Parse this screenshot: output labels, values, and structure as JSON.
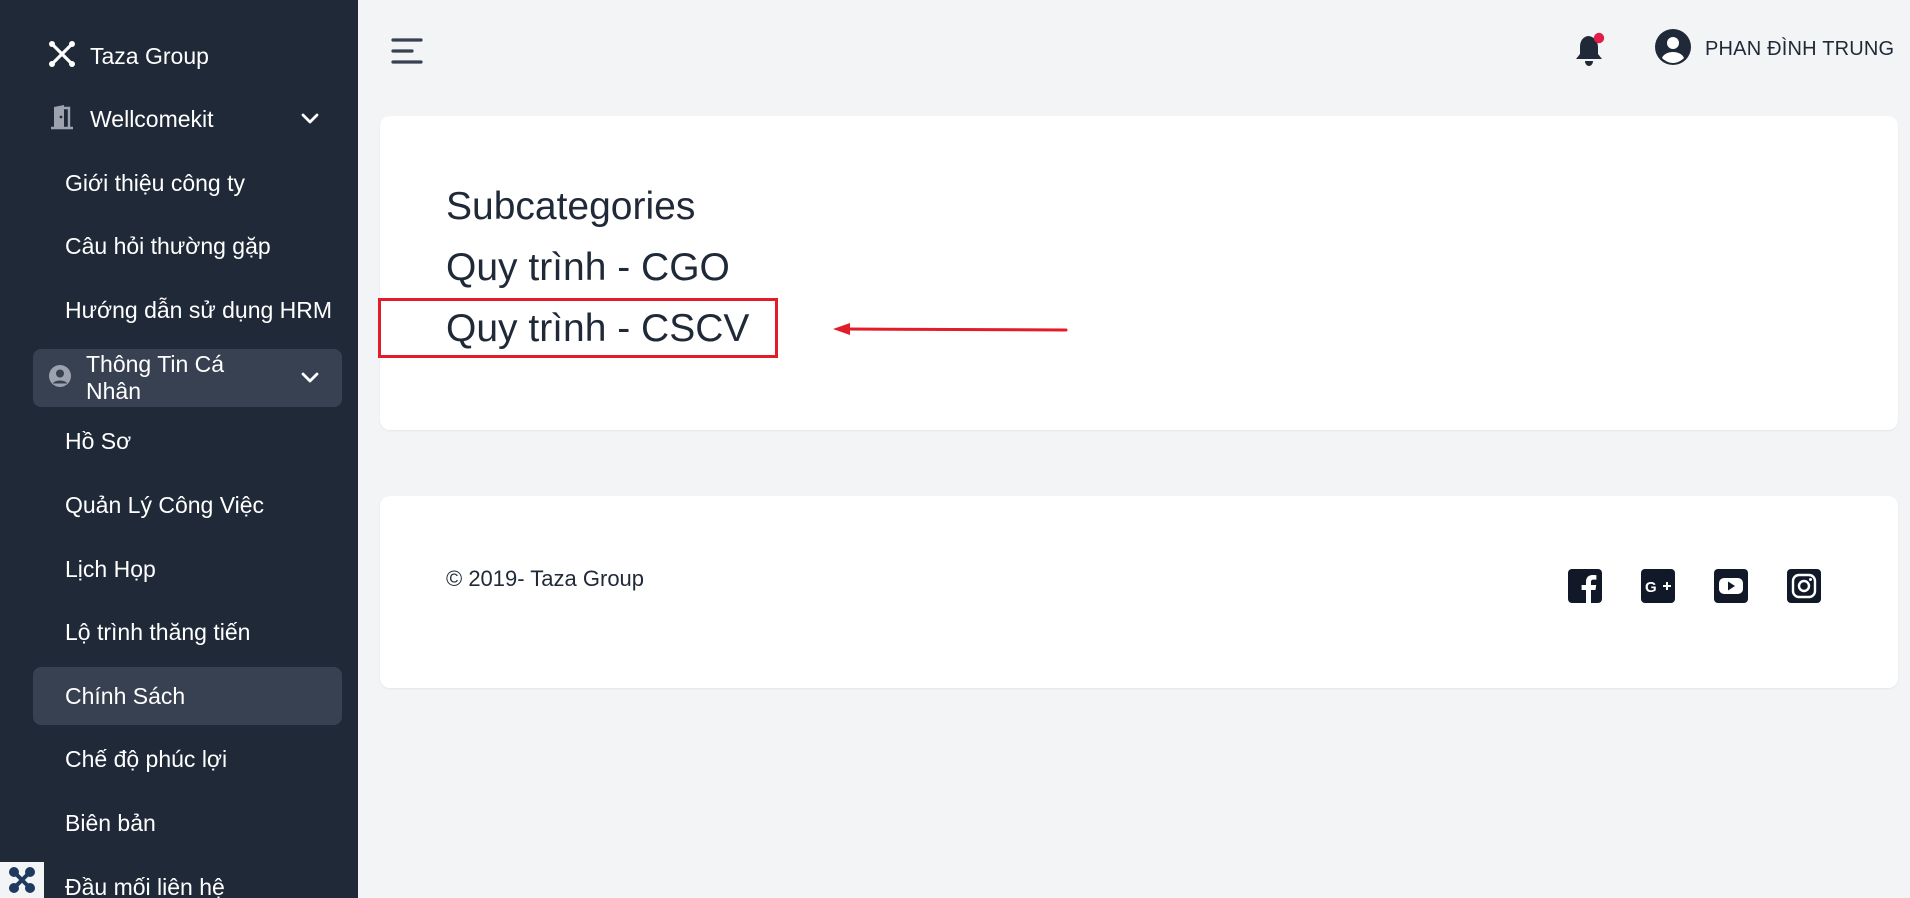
{
  "sidebar": {
    "brand": {
      "label": "Taza Group",
      "icon": "taza-logo-icon"
    },
    "groups": [
      {
        "label": "Wellcomekit",
        "icon": "door-icon"
      },
      {
        "label": "Thông Tin Cá Nhân",
        "icon": "user-circle-icon"
      }
    ],
    "items": [
      {
        "label": "Giới thiệu công ty"
      },
      {
        "label": "Câu hỏi thường gặp"
      },
      {
        "label": "Hướng dẫn sử dụng HRM"
      },
      {
        "label": "Hồ Sơ"
      },
      {
        "label": "Quản Lý Công Việc"
      },
      {
        "label": "Lịch Họp"
      },
      {
        "label": "Lộ trình thăng tiến"
      },
      {
        "label": "Chính Sách"
      },
      {
        "label": "Chế độ phúc lợi"
      },
      {
        "label": "Biên bản"
      },
      {
        "label": "Đầu mối liên hệ"
      }
    ]
  },
  "header": {
    "user_name": "PHAN ĐÌNH TRUNG"
  },
  "main": {
    "heading": "Subcategories",
    "links": [
      {
        "label": "Quy trình - CGO"
      },
      {
        "label": "Quy trình - CSCV"
      }
    ]
  },
  "footer": {
    "copyright": "© 2019- Taza Group",
    "social": [
      "facebook-icon",
      "google-plus-icon",
      "youtube-icon",
      "instagram-icon"
    ]
  },
  "colors": {
    "sidebar_bg": "#1f2937",
    "active_bg": "#374151",
    "page_bg": "#f3f4f6",
    "annotation_red": "#e11d2a",
    "notification_dot": "#e11d48"
  }
}
